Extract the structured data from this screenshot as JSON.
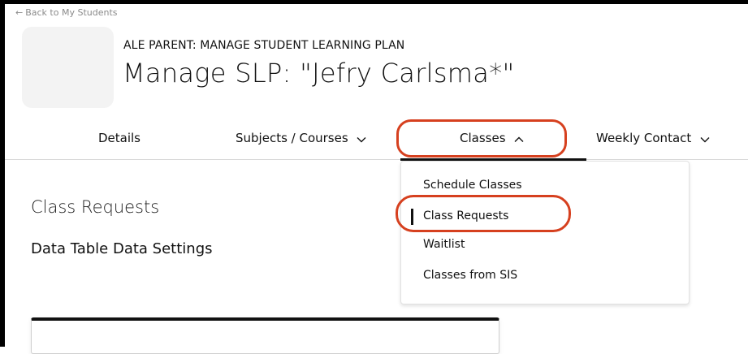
{
  "back_link": {
    "arrow": "←",
    "label": "Back to My Students"
  },
  "header": {
    "kicker": "ALE PARENT: MANAGE STUDENT LEARNING PLAN",
    "title": "Manage SLP: \"Jefry Carlsma*\""
  },
  "nav": {
    "tabs": [
      {
        "label": "Details",
        "has_chevron": false
      },
      {
        "label": "Subjects / Courses",
        "has_chevron": true,
        "chevron": "chevron-down-icon"
      },
      {
        "label": "Classes",
        "has_chevron": true,
        "chevron": "chevron-up-icon",
        "active": true,
        "expanded": true
      },
      {
        "label": "Weekly Contact",
        "has_chevron": true,
        "chevron": "chevron-down-icon"
      }
    ]
  },
  "dropdown": {
    "items": [
      {
        "label": "Schedule Classes",
        "selected": false
      },
      {
        "label": "Class Requests",
        "selected": true
      },
      {
        "label": "Waitlist",
        "selected": false
      },
      {
        "label": "Classes from SIS",
        "selected": false
      }
    ]
  },
  "main": {
    "section_title": "Class Requests",
    "section_subtitle": "Data Table Data Settings"
  },
  "colors": {
    "highlight": "#d6401f",
    "text": "#111111",
    "muted": "#8a8a8a",
    "avatar_bg": "#f3f3f3"
  }
}
